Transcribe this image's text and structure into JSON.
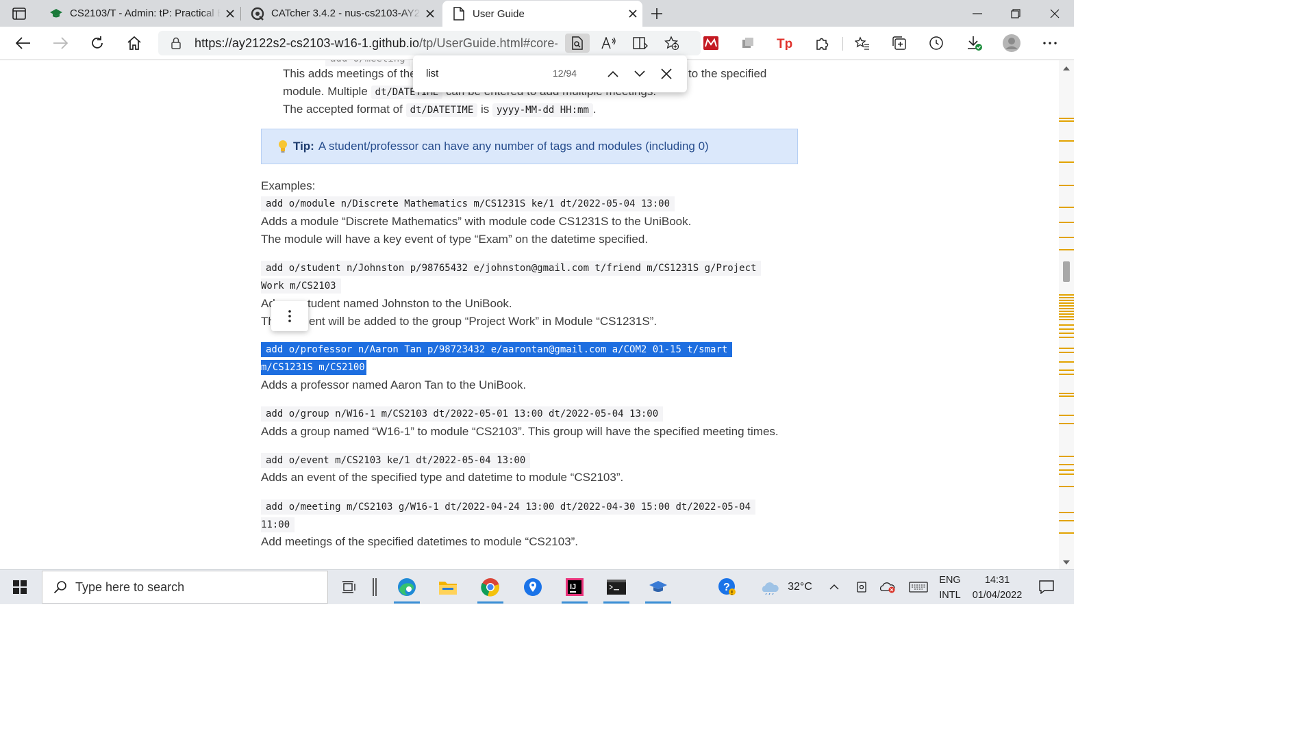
{
  "tabs": [
    {
      "title": "CS2103/T - Admin: tP: Practical E",
      "icon": "graduation-cap-icon",
      "active": false
    },
    {
      "title": "CATcher 3.4.2 - nus-cs2103-AY21",
      "icon": "catcher-icon",
      "active": false
    },
    {
      "title": "User Guide",
      "icon": "document-icon",
      "active": true
    }
  ],
  "address_bar": {
    "url_host": "https://ay2122s2-cs2103-w16-1.github.io",
    "url_path": "/tp/UserGuide.html#core-f..."
  },
  "find_bar": {
    "query": "list",
    "match_count": "12/94"
  },
  "page": {
    "intro_line1_pre": "This adds meetings of the",
    "intro_line1_post": "to the specified",
    "intro_line2_pre": "module. Multiple",
    "intro_line2_code": "dt/DATETIME",
    "intro_line2_post": "can be entered to add multiple meetings.",
    "intro_line3_pre": "The accepted format of",
    "intro_line3_code1": "dt/DATETIME",
    "intro_line3_mid": "is",
    "intro_line3_code2": "yyyy-MM-dd HH:mm",
    "intro_line3_post": ".",
    "tip_label": "Tip:",
    "tip_text": "A student/professor can have any number of tags and modules (including 0)",
    "examples_heading": "Examples:",
    "ex1_code": "add o/module n/Discrete Mathematics m/CS1231S ke/1 dt/2022-05-04 13:00",
    "ex1_desc1": "Adds a module “Discrete Mathematics” with module code CS1231S to the UniBook.",
    "ex1_desc2": "The module will have a key event of type “Exam” on the datetime specified.",
    "ex2_code1": "add o/student n/Johnston p/98765432 e/johnston@gmail.com t/friend m/CS1231S g/Project",
    "ex2_code2": "Work m/CS2103",
    "ex2_desc1_a": "Ad",
    "ex2_desc1_b": "tudent named Johnston to the UniBook.",
    "ex2_desc2_a": "Th",
    "ex2_desc2_b": "ent will be added to the group “Project Work” in Module “CS1231S”.",
    "ex3_code1": "add o/professor n/Aaron Tan p/98723432 e/aarontan@gmail.com a/COM2 01-15 t/smart",
    "ex3_code2": "m/CS1231S m/CS2100",
    "ex3_desc": "Adds a professor named Aaron Tan to the UniBook.",
    "ex4_code": "add o/group n/W16-1 m/CS2103 dt/2022-05-01 13:00 dt/2022-05-04 13:00",
    "ex4_desc": "Adds a group named “W16-1” to module “CS2103”. This group will have the specified meeting times.",
    "ex5_code": "add o/event m/CS2103 ke/1 dt/2022-05-04 13:00",
    "ex5_desc": "Adds an event of the specified type and datetime to module “CS2103”.",
    "ex6_code1": "add o/meeting m/CS2103 g/W16-1 dt/2022-04-24 13:00 dt/2022-04-30 15:00 dt/2022-05-04",
    "ex6_code2": "11:00",
    "ex6_desc": "Add meetings of the specified datetimes to module “CS2103”."
  },
  "taskbar": {
    "search_placeholder": "Type here to search",
    "temperature": "32°C",
    "lang_top": "ENG",
    "lang_bottom": "INTL",
    "time": "14:31",
    "date": "01/04/2022"
  },
  "colors": {
    "selection": "#1d6ee0",
    "tip_background": "#dbe8fb",
    "scroll_marker": "#e2a300"
  }
}
